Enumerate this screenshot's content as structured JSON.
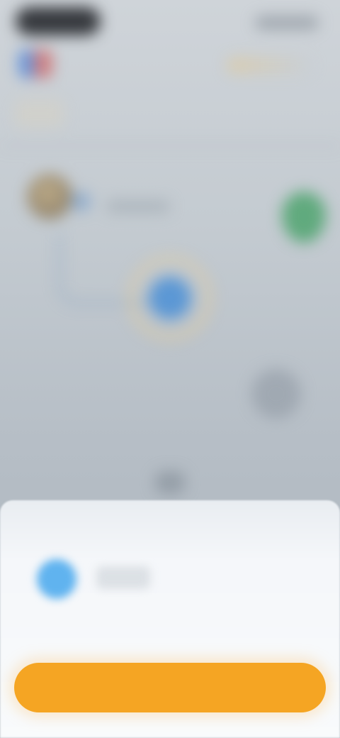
{
  "map": {
    "route_state": "blurred",
    "markers": [
      {
        "icon": "user-avatar"
      },
      {
        "icon": "location-pin",
        "color": "#3f9f61"
      },
      {
        "icon": "current-location-dot",
        "color": "#4a8fd6"
      }
    ]
  },
  "bottom_sheet": {
    "icon_color": "#60b3ef",
    "label": "",
    "action": {
      "label": "",
      "color": "#f5a523"
    }
  }
}
